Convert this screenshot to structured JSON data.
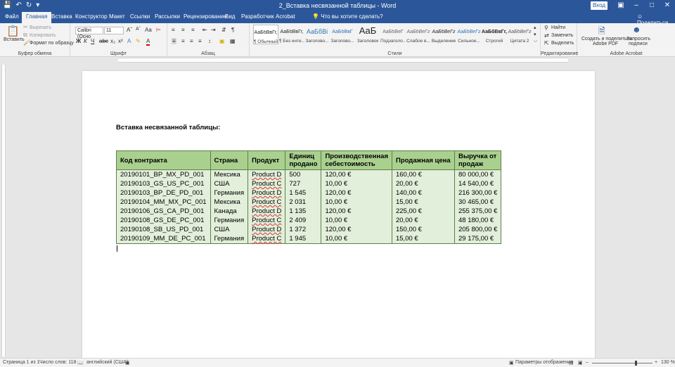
{
  "titlebar": {
    "title": "2_Вставка несвязанной таблицы  -  Word",
    "login": "Вход",
    "qat": [
      "save-icon",
      "undo-icon",
      "redo-icon",
      "customize-icon"
    ],
    "controls": [
      "restore-icon",
      "minimize-icon",
      "maximize-icon",
      "close-icon"
    ]
  },
  "tabs": {
    "items": [
      "Файл",
      "Главная",
      "Вставка",
      "Конструктор",
      "Макет",
      "Ссылки",
      "Рассылки",
      "Рецензирование",
      "Вид",
      "Разработчик",
      "Acrobat"
    ],
    "tell_me": "Что вы хотите сделать?",
    "share": "Поделиться"
  },
  "ribbon": {
    "clipboard": {
      "label": "Буфер обмена",
      "paste": "Вставить",
      "cut": "Вырезать",
      "copy": "Копировать",
      "format_painter": "Формат по образцу"
    },
    "font": {
      "label": "Шрифт",
      "family": "Calibri (Осно",
      "size": "11",
      "bold": "Ж",
      "italic": "К",
      "underline": "Ч",
      "font_color_letter": "А"
    },
    "paragraph": {
      "label": "Абзац"
    },
    "styles": {
      "label": "Стили",
      "items": [
        {
          "sample": "АаБбВвГг,",
          "name": "¶ Обычный"
        },
        {
          "sample": "АаБбВвГг,",
          "name": "¶ Без инте..."
        },
        {
          "sample": "АаБбВі",
          "name": "Заголово..."
        },
        {
          "sample": "АаБбВвГ",
          "name": "Заголово..."
        },
        {
          "sample": "АаБ",
          "name": "Заголовок"
        },
        {
          "sample": "АаБбВеГ",
          "name": "Подзаголо..."
        },
        {
          "sample": "АаБбВеГг",
          "name": "Слабое в..."
        },
        {
          "sample": "АаБбВеГг",
          "name": "Выделение"
        },
        {
          "sample": "АаБбВеГг",
          "name": "Сильное..."
        },
        {
          "sample": "АаБбВвГг,",
          "name": "Строгий"
        },
        {
          "sample": "АаБбВеГг",
          "name": "Цитата 2"
        }
      ]
    },
    "editing": {
      "label": "Редактирование",
      "find": "Найти",
      "replace": "Заменить",
      "select": "Выделить"
    },
    "acrobat": {
      "label": "Adobe Acrobat",
      "create_share": "Создать и поделиться",
      "create_share_2": "Adobe PDF",
      "request_sign": "Запросить",
      "request_sign_2": "подписи"
    }
  },
  "document": {
    "heading": "Вставка несвязанной таблицы:",
    "table": {
      "headers": [
        "Код контракта",
        "Страна",
        "Продукт",
        "Единиц продано",
        "Производственная себестоимость",
        "Продажная цена",
        "Выручка от продаж"
      ],
      "rows": [
        [
          "20190101_BP_MX_PD_001",
          "Мексика",
          "Product D",
          "500",
          "120,00 €",
          "160,00 €",
          "80 000,00 €"
        ],
        [
          "20190103_GS_US_PC_001",
          "США",
          "Product C",
          "727",
          "10,00 €",
          "20,00 €",
          "14 540,00 €"
        ],
        [
          "20190103_BP_DE_PD_001",
          "Германия",
          "Product D",
          "1 545",
          "120,00 €",
          "140,00 €",
          "216 300,00 €"
        ],
        [
          "20190104_MM_MX_PC_001",
          "Мексика",
          "Product C",
          "2 031",
          "10,00 €",
          "15,00 €",
          "30 465,00 €"
        ],
        [
          "20190106_GS_CA_PD_001",
          "Канада",
          "Product D",
          "1 135",
          "120,00 €",
          "225,00 €",
          "255 375,00 €"
        ],
        [
          "20190108_GS_DE_PC_001",
          "Германия",
          "Product C",
          "2 409",
          "10,00 €",
          "20,00 €",
          "48 180,00 €"
        ],
        [
          "20190108_SB_US_PD_001",
          "США",
          "Product D",
          "1 372",
          "120,00 €",
          "150,00 €",
          "205 800,00 €"
        ],
        [
          "20190109_MM_DE_PC_001",
          "Германия",
          "Product C",
          "1 945",
          "10,00 €",
          "15,00 €",
          "29 175,00 €"
        ]
      ]
    }
  },
  "statusbar": {
    "page": "Страница 1 из 1",
    "words": "Число слов: 118",
    "language": "английский (США)",
    "display_settings": "Параметры отображения",
    "zoom": "130 %"
  },
  "colors": {
    "accent": "#2b579a",
    "header_fill": "#a9d08e",
    "row_fill": "#e2efda"
  }
}
